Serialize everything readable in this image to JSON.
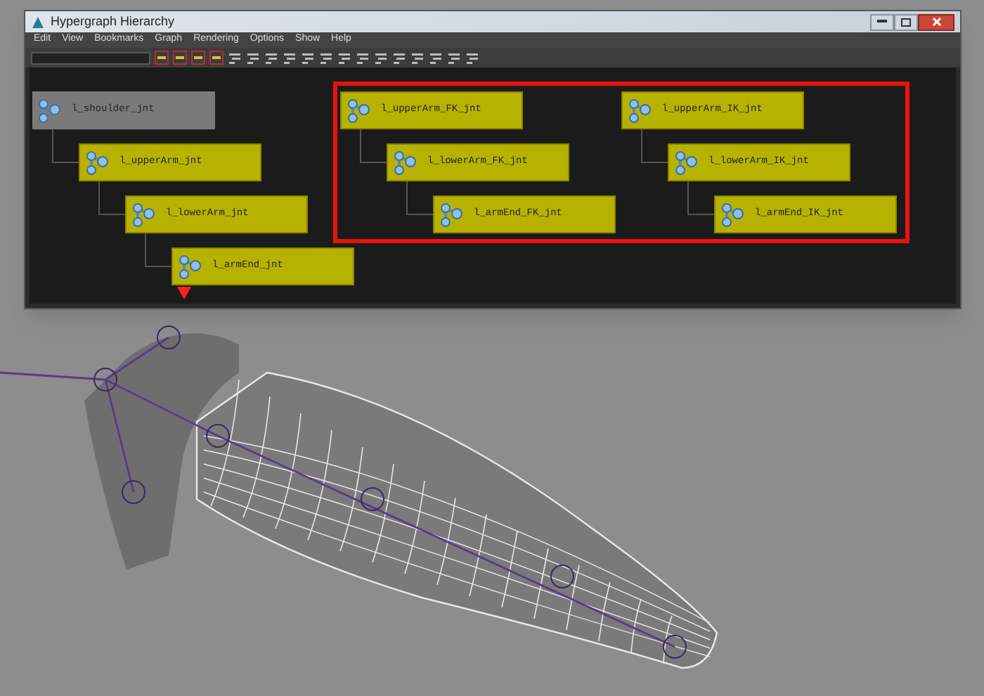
{
  "window": {
    "title": "Hypergraph Hierarchy"
  },
  "menu": [
    "Edit",
    "View",
    "Bookmarks",
    "Graph",
    "Rendering",
    "Options",
    "Show",
    "Help"
  ],
  "nodes": [
    {
      "label": "l_shoulder_jnt",
      "selected": true,
      "children": [
        {
          "label": "l_upperArm_jnt",
          "selected": false,
          "children": [
            {
              "label": "l_lowerArm_jnt",
              "selected": false,
              "children": [
                {
                  "label": "l_armEnd_jnt",
                  "selected": false
                }
              ]
            }
          ]
        }
      ]
    },
    {
      "label": "l_upperArm_FK_jnt",
      "selected": false,
      "children": [
        {
          "label": "l_lowerArm_FK_jnt",
          "selected": false,
          "children": [
            {
              "label": "l_armEnd_FK_jnt",
              "selected": false
            }
          ]
        }
      ]
    },
    {
      "label": "l_upperArm_IK_jnt",
      "selected": false,
      "children": [
        {
          "label": "l_lowerArm_IK_jnt",
          "selected": false,
          "children": [
            {
              "label": "l_armEnd_IK_jnt",
              "selected": false
            }
          ]
        }
      ]
    }
  ]
}
